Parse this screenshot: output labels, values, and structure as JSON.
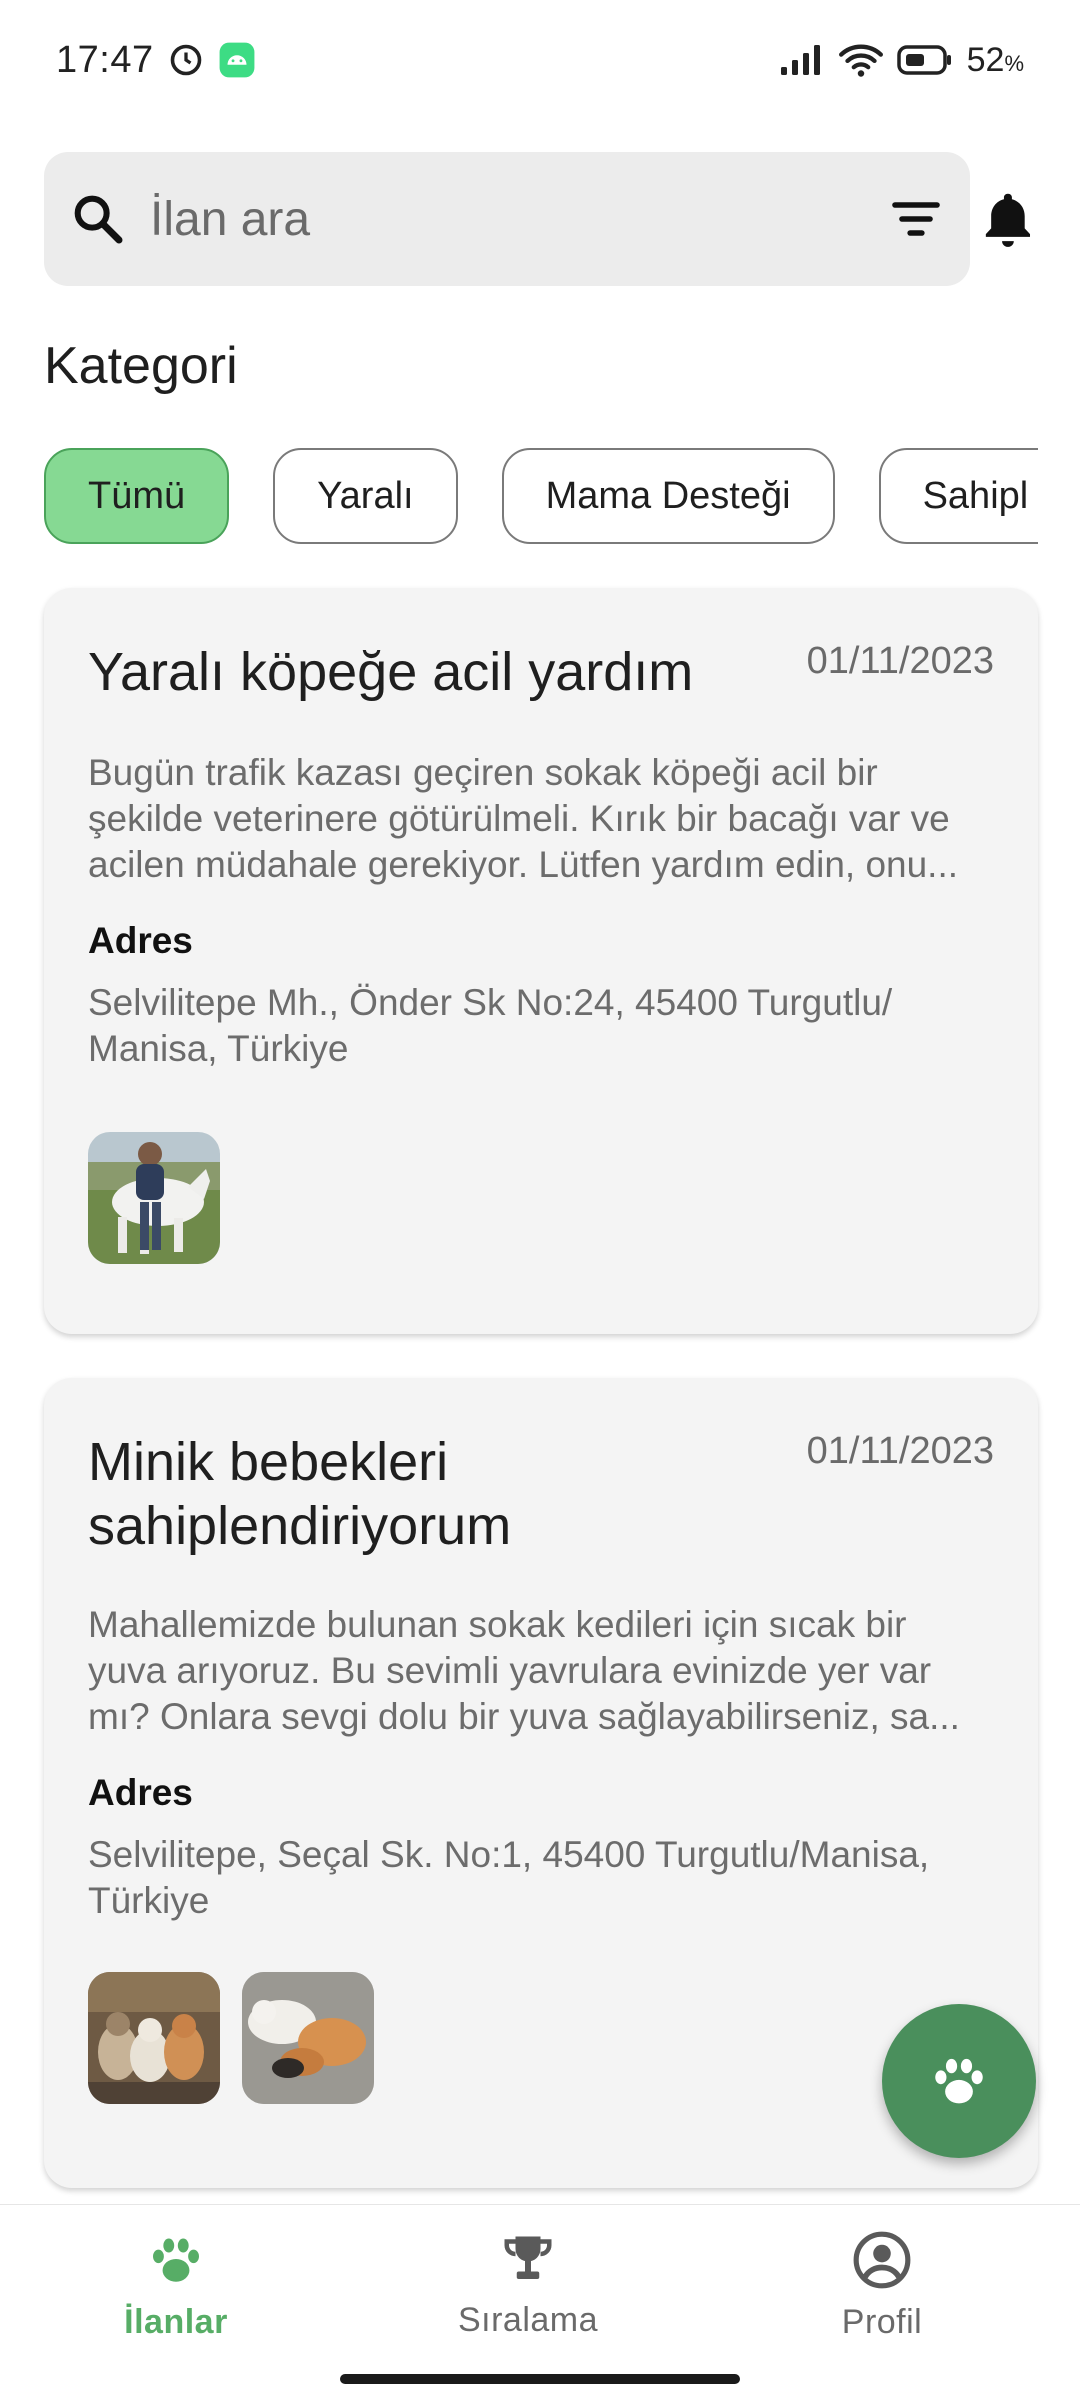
{
  "status_bar": {
    "time": "17:47",
    "battery_percent": "52",
    "battery_unit": "%"
  },
  "search": {
    "placeholder": "İlan ara",
    "icons": [
      "search-icon",
      "filter-icon",
      "bell-icon"
    ]
  },
  "category": {
    "title": "Kategori",
    "chips": [
      {
        "label": "Tümü",
        "active": true
      },
      {
        "label": "Yaralı",
        "active": false
      },
      {
        "label": "Mama Desteği",
        "active": false
      },
      {
        "label": "Sahipl",
        "active": false
      }
    ]
  },
  "posts": [
    {
      "title": "Yaralı köpeğe acil yardım",
      "date": "01/11/2023",
      "description": "Bugün trafik kazası geçiren sokak köpeği acil bir şekilde veterinere götürülmeli. Kırık bir bacağı var ve acilen müdahale gerekiyor. Lütfen yardım edin, onu...",
      "address_label": "Adres",
      "address": "Selvilitepe Mh., Önder Sk No:24, 45400 Turgutlu/ Manisa, Türkiye"
    },
    {
      "title": "Minik bebekleri sahiplendiriyorum",
      "date": "01/11/2023",
      "description": "Mahallemizde bulunan sokak kedileri için sıcak bir yuva arıyoruz. Bu sevimli yavrulara evinizde yer var mı? Onlara sevgi dolu bir yuva sağlayabilirseniz, sa...",
      "address_label": "Adres",
      "address": "Selvilitepe, Seçal Sk. No:1, 45400 Turgutlu/Manisa, Türkiye"
    }
  ],
  "bottom_nav": [
    {
      "label": "İlanlar",
      "icon": "paw-icon",
      "active": true
    },
    {
      "label": "Sıralama",
      "icon": "trophy-icon",
      "active": false
    },
    {
      "label": "Profil",
      "icon": "profile-icon",
      "active": false
    }
  ],
  "colors": {
    "accent_green": "#57ad66",
    "chip_active_bg": "#86d993",
    "fab_bg": "#4a8f5c"
  }
}
